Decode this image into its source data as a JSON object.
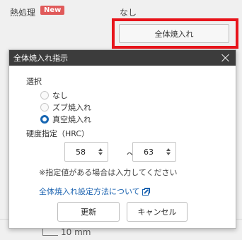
{
  "background": {
    "label": "熱処理",
    "badge": "New",
    "value": "なし",
    "button_label": "全体焼入れ",
    "bottom_dimension": "10 mm"
  },
  "modal": {
    "title": "全体焼入れ指示",
    "select_label": "選択",
    "options": [
      {
        "label": "なし",
        "selected": false
      },
      {
        "label": "ズブ焼入れ",
        "selected": false
      },
      {
        "label": "真空焼入れ",
        "selected": true
      }
    ],
    "hardness_label": "硬度指定（HRC）",
    "hardness_min": "58",
    "range_separator": "〜",
    "hardness_max": "63",
    "note": "※指定値がある場合は入力してください",
    "help_link": "全体焼入れ設定方法について",
    "update_button": "更新",
    "cancel_button": "キャンセル"
  },
  "colors": {
    "highlight": "#e8141b",
    "badge": "#e05a5a",
    "header": "#3c3c3c",
    "radio_selected": "#1766b2",
    "link": "#1a62b0"
  }
}
